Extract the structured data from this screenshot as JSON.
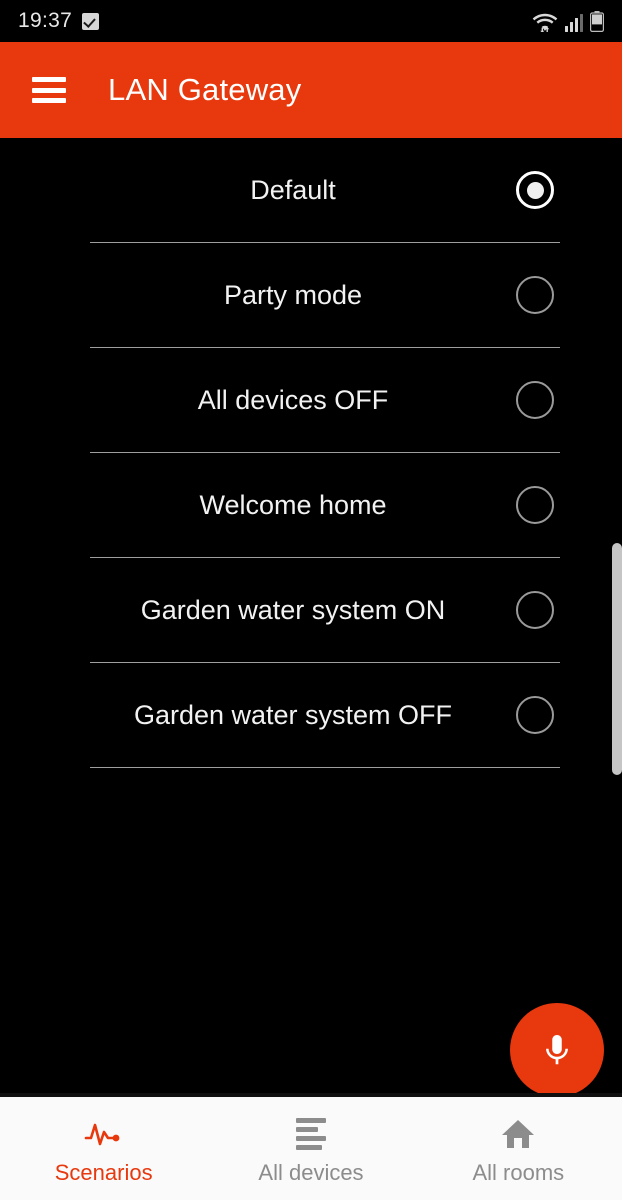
{
  "status_bar": {
    "time": "19:37",
    "icons": {
      "checkbox": "checkbox-checked-icon",
      "wifi": "wifi-transfer-icon",
      "signal": "cellular-signal-icon",
      "battery": "battery-icon"
    }
  },
  "app_bar": {
    "menu_icon": "hamburger-menu-icon",
    "title": "LAN Gateway",
    "background_color": "#e8380d"
  },
  "scenarios": {
    "items": [
      {
        "label": "Default",
        "selected": true
      },
      {
        "label": "Party mode",
        "selected": false
      },
      {
        "label": "All devices OFF",
        "selected": false
      },
      {
        "label": "Welcome home",
        "selected": false
      },
      {
        "label": "Garden water system ON",
        "selected": false
      },
      {
        "label": "Garden water system OFF",
        "selected": false
      }
    ]
  },
  "fab": {
    "icon": "microphone-icon",
    "color": "#e8380d"
  },
  "bottom_nav": {
    "active_color": "#e8380d",
    "inactive_color": "#8c8c8c",
    "items": [
      {
        "label": "Scenarios",
        "icon": "pulse-waveform-icon",
        "active": true
      },
      {
        "label": "All devices",
        "icon": "list-lines-icon",
        "active": false
      },
      {
        "label": "All rooms",
        "icon": "home-icon",
        "active": false
      }
    ]
  }
}
